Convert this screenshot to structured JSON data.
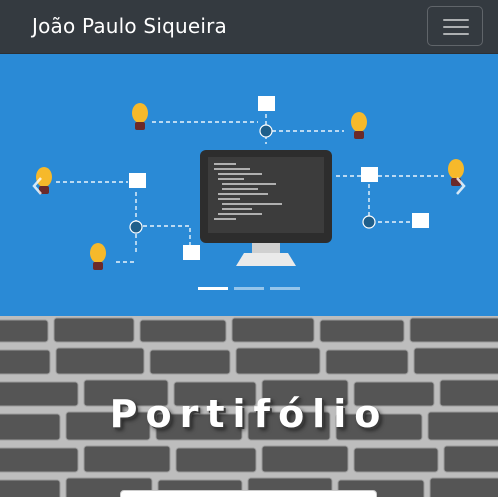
{
  "navbar": {
    "brand": "João Paulo Siqueira",
    "toggler_icon": "hamburger-menu-icon"
  },
  "carousel": {
    "background": "#2a8ad6",
    "slide_illustration": "computer-monitor-with-code-and-lightbulbs",
    "prev_icon": "chevron-left-icon",
    "next_icon": "chevron-right-icon",
    "slide_count": 3,
    "active_slide": 1
  },
  "portfolio": {
    "title": "Portifólio",
    "background": "gray-brick-wall"
  },
  "colors": {
    "navbar": "#343a40",
    "carousel_blue": "#2a8ad6",
    "monitor": "#2d2d2d",
    "bulb": "#f6b92b",
    "gear": "#1f5f8b"
  }
}
